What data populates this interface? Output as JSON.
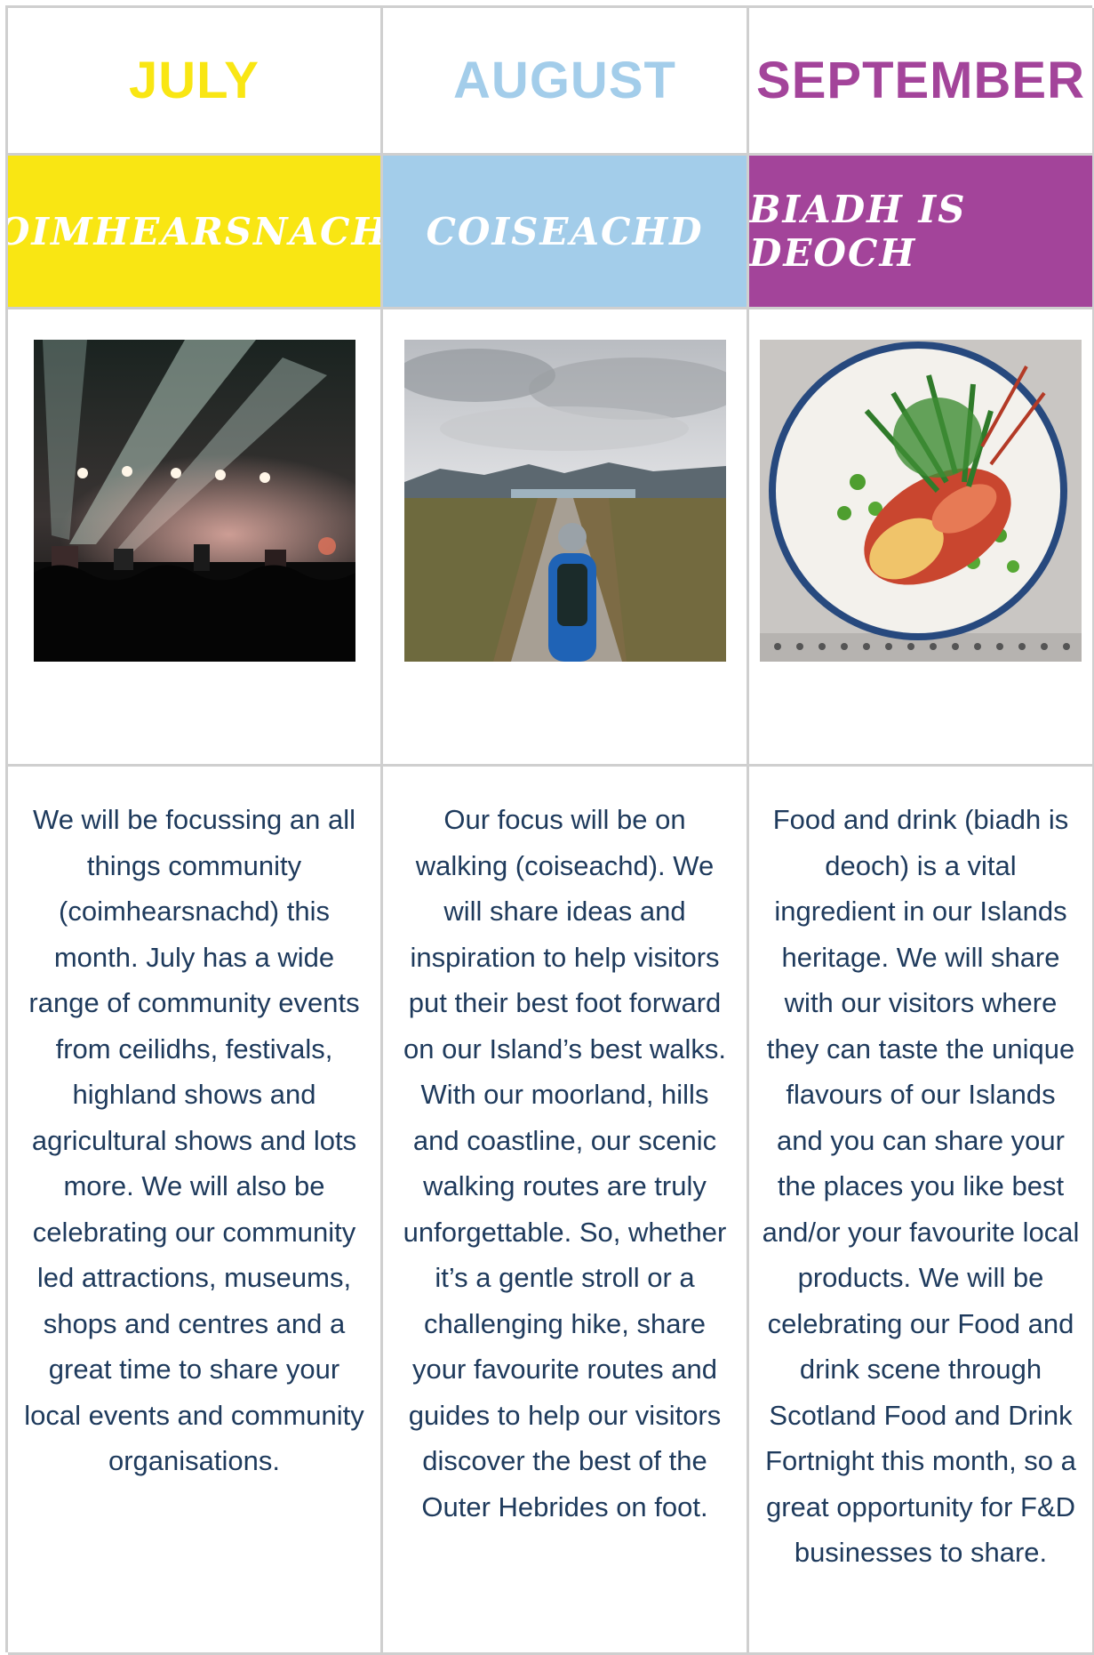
{
  "colors": {
    "july": "#f9e613",
    "august": "#a3cdea",
    "september": "#a3449a",
    "text": "#1e3a5c",
    "grid": "#cfcfcf"
  },
  "columns": [
    {
      "month": "JULY",
      "theme": "COIMHEARSNACHD",
      "photo": "concert-stage-photo",
      "text": "We will be focussing an all things community (coimhearsnachd) this month. July has a wide range of community events from ceilidhs, festivals, highland shows and agricultural shows and lots more. We will also be celebrating our community led attractions, museums, shops and centres and a great time to share your local events and community organisations."
    },
    {
      "month": "AUGUST",
      "theme": "COISEACHD",
      "photo": "hiker-path-photo",
      "text": "Our focus will be on walking (coiseachd). We will share ideas and inspiration to help visitors put their best foot forward on our Island’s best walks. With our moorland, hills and coastline, our scenic walking routes are truly unforgettable.  So, whether it’s a gentle stroll or a challenging hike, share your favourite routes and guides to help our visitors discover the best of the Outer Hebrides on foot."
    },
    {
      "month": "SEPTEMBER",
      "theme": "BIADH IS DEOCH",
      "photo": "lobster-dish-photo",
      "text": "Food and drink (biadh is deoch) is a vital ingredient in our Islands heritage. We will share with our visitors where they can taste the unique flavours of our Islands and you can share your the places you like best and/or your favourite local products.  We will be celebrating our Food and drink scene through Scotland Food and Drink Fortnight this month, so a great opportunity for F&D businesses to share."
    }
  ]
}
